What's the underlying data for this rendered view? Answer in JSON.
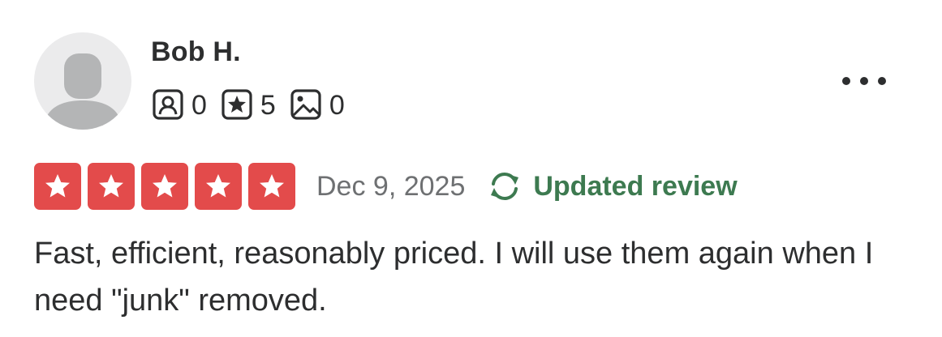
{
  "user": {
    "name": "Bob H.",
    "avatar_icon": "default-user-avatar",
    "stats": [
      {
        "icon": "review-count-icon",
        "value": "0"
      },
      {
        "icon": "star-count-icon",
        "value": "5"
      },
      {
        "icon": "photo-count-icon",
        "value": "0"
      }
    ]
  },
  "menu": {
    "icon": "more-options-icon"
  },
  "review": {
    "rating": 5,
    "rating_max": 5,
    "date": "Dec 9, 2025",
    "updated_label": "Updated review",
    "text": "Fast, efficient, reasonably priced. I will use them again when I need \"junk\" removed."
  },
  "colors": {
    "star_background": "#e34b4b",
    "updated_green": "#3d7a50",
    "date_gray": "#6e7072",
    "text_dark": "#2d2e2f",
    "avatar_background": "#ebebec",
    "avatar_silhouette": "#b4b5b6"
  }
}
